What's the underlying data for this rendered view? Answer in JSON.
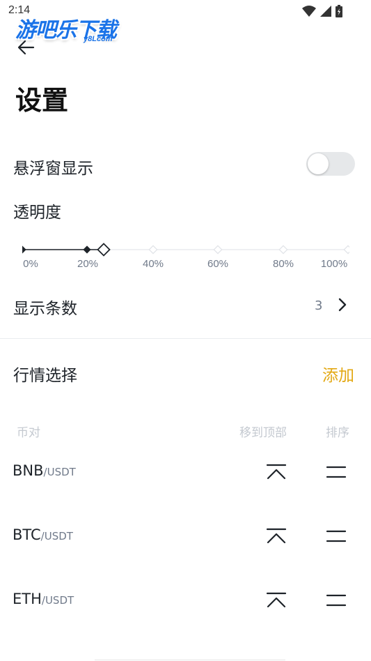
{
  "status_bar": {
    "time": "2:14"
  },
  "watermark": {
    "text": "游吧乐下载",
    "sub": "y8Lcom"
  },
  "header": {
    "title": "设置"
  },
  "settings": {
    "floating_window_label": "悬浮窗显示",
    "floating_window_enabled": false,
    "opacity_label": "透明度",
    "opacity_ticks": [
      "0%",
      "20%",
      "40%",
      "60%",
      "80%",
      "100%"
    ],
    "opacity_value_percent": 25,
    "display_count_label": "显示条数",
    "display_count_value": "3"
  },
  "market": {
    "label": "行情选择",
    "add_label": "添加",
    "columns": {
      "pair": "币对",
      "move_top": "移到顶部",
      "sort": "排序"
    },
    "pairs": [
      {
        "base": "BNB",
        "quote": "/USDT"
      },
      {
        "base": "BTC",
        "quote": "/USDT"
      },
      {
        "base": "ETH",
        "quote": "/USDT"
      }
    ]
  },
  "colors": {
    "accent": "#e3a813",
    "toggle_off": "#e6e8ea",
    "text": "#1e2329",
    "muted": "#707a8a"
  }
}
